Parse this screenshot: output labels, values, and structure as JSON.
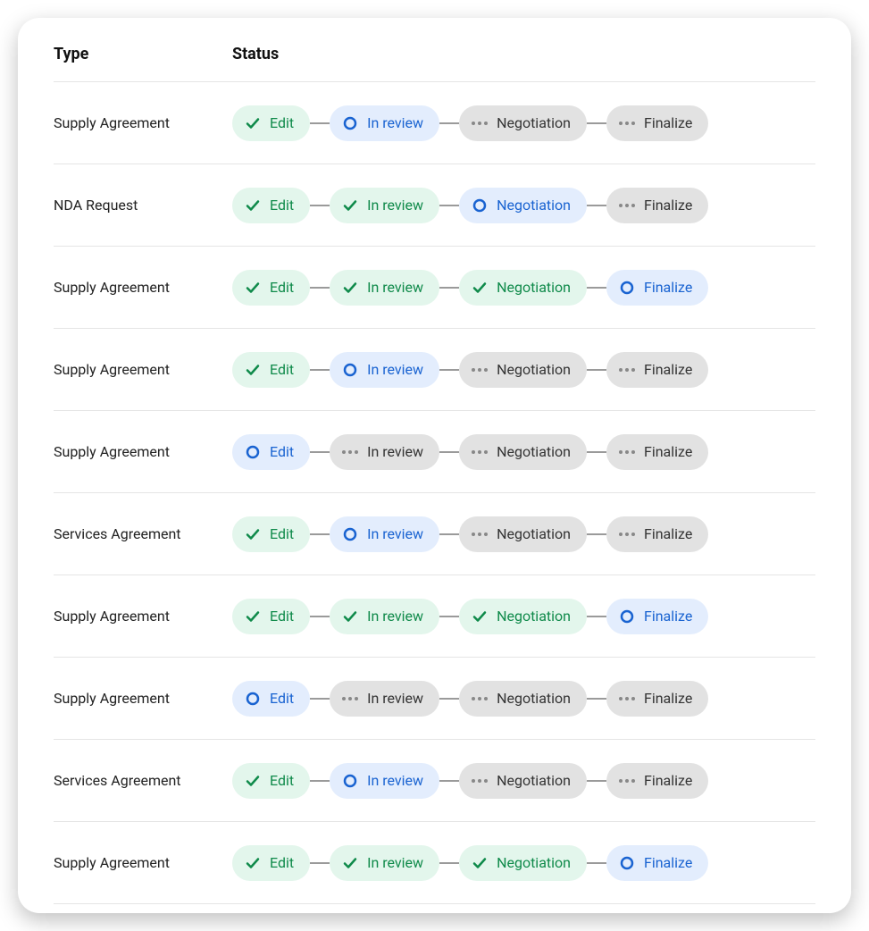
{
  "columns": {
    "type": "Type",
    "status": "Status"
  },
  "stage_labels": [
    "Edit",
    "In review",
    "Negotiation",
    "Finalize"
  ],
  "states": {
    "done": "done",
    "current": "current",
    "pending": "pending"
  },
  "colors": {
    "done_bg": "#e3f6ec",
    "done_text": "#0f8a4a",
    "current_bg": "#e3edfd",
    "current_text": "#1963d1",
    "pending_bg": "#e2e2e2",
    "pending_text": "#333333"
  },
  "rows": [
    {
      "type": "Supply Agreement",
      "stages": [
        "done",
        "current",
        "pending",
        "pending"
      ]
    },
    {
      "type": "NDA Request",
      "stages": [
        "done",
        "done",
        "current",
        "pending"
      ]
    },
    {
      "type": "Supply Agreement",
      "stages": [
        "done",
        "done",
        "done",
        "current"
      ]
    },
    {
      "type": "Supply Agreement",
      "stages": [
        "done",
        "current",
        "pending",
        "pending"
      ]
    },
    {
      "type": "Supply Agreement",
      "stages": [
        "current",
        "pending",
        "pending",
        "pending"
      ]
    },
    {
      "type": "Services Agreement",
      "stages": [
        "done",
        "current",
        "pending",
        "pending"
      ]
    },
    {
      "type": "Supply Agreement",
      "stages": [
        "done",
        "done",
        "done",
        "current"
      ]
    },
    {
      "type": "Supply Agreement",
      "stages": [
        "current",
        "pending",
        "pending",
        "pending"
      ]
    },
    {
      "type": "Services Agreement",
      "stages": [
        "done",
        "current",
        "pending",
        "pending"
      ]
    },
    {
      "type": "Supply Agreement",
      "stages": [
        "done",
        "done",
        "done",
        "current"
      ]
    }
  ]
}
